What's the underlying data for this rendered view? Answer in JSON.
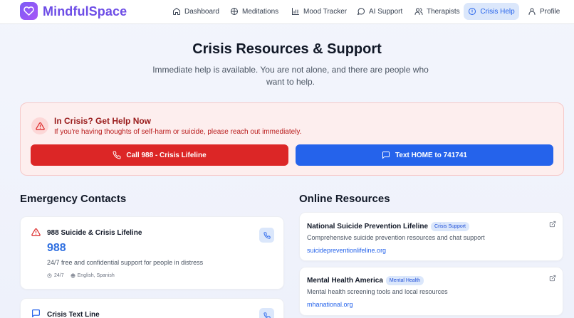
{
  "app": {
    "name": "MindfulSpace"
  },
  "nav": {
    "items": [
      {
        "label": "Dashboard",
        "icon": "home-icon"
      },
      {
        "label": "Meditations",
        "icon": "meditation-icon"
      },
      {
        "label": "Mood Tracker",
        "icon": "chart-icon"
      },
      {
        "label": "AI Support",
        "icon": "chat-icon"
      },
      {
        "label": "Therapists",
        "icon": "users-icon"
      },
      {
        "label": "Crisis Help",
        "icon": "info-circle-icon",
        "active": true
      },
      {
        "label": "Profile",
        "icon": "user-icon"
      }
    ]
  },
  "header": {
    "title": "Crisis Resources & Support",
    "subtitle": "Immediate help is available. You are not alone, and there are people who want to help."
  },
  "crisis": {
    "title": "In Crisis? Get Help Now",
    "description": "If you're having thoughts of self-harm or suicide, please reach out immediately.",
    "call_button": "Call 988 - Crisis Lifeline",
    "text_button": "Text HOME to 741741"
  },
  "emergency": {
    "title": "Emergency Contacts",
    "contacts": [
      {
        "name": "988 Suicide & Crisis Lifeline",
        "number": "988",
        "description": "24/7 free and confidential support for people in distress",
        "hours": "24/7",
        "languages": "English, Spanish"
      },
      {
        "name": "Crisis Text Line"
      }
    ]
  },
  "online": {
    "title": "Online Resources",
    "resources": [
      {
        "name": "National Suicide Prevention Lifeline",
        "badge": "Crisis Support",
        "description": "Comprehensive suicide prevention resources and chat support",
        "link": "suicidepreventionlifeline.org"
      },
      {
        "name": "Mental Health America",
        "badge": "Mental Health",
        "description": "Mental health screening tools and local resources",
        "link": "mhanational.org"
      }
    ]
  },
  "colors": {
    "brand": "#6d4de6",
    "danger": "#dc2626",
    "primary": "#2563eb"
  }
}
